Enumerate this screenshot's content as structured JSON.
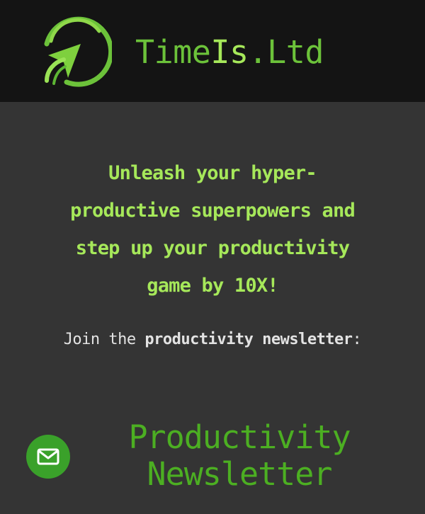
{
  "header": {
    "brand_part1": "Time",
    "brand_part2": "Is",
    "brand_part3": ".Ltd",
    "logo_icon": "green-swoosh-arrow-logo"
  },
  "hero": {
    "headline_line1": "Unleash your hyper-",
    "headline_line2": "productive superpowers and",
    "headline_line3": "step up your productivity",
    "headline_line4": "game by 10X!",
    "join_prefix": "Join the ",
    "join_bold": "productivity newsletter",
    "join_suffix": ":"
  },
  "newsletter": {
    "title_line1": "Productivity",
    "title_line2": "Newsletter",
    "mail_icon": "envelope-icon"
  },
  "colors": {
    "header_bg": "#141414",
    "page_bg": "#343434",
    "accent_light_green": "#a6e85a",
    "brand_green": "#6cc23a",
    "button_green": "#3aa12a",
    "newsletter_green": "#4caf22",
    "body_text": "#e3e3e3"
  }
}
